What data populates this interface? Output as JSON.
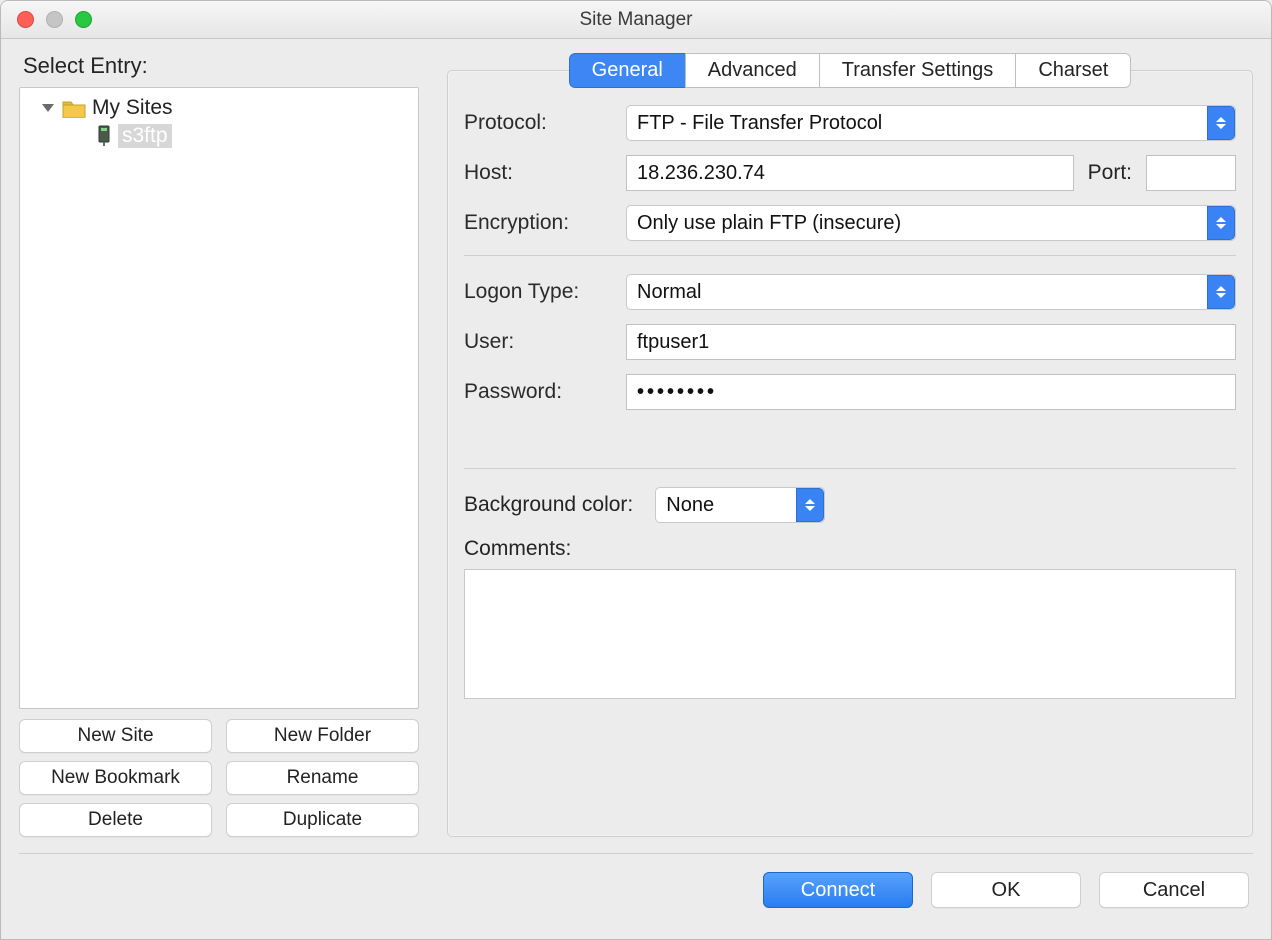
{
  "window": {
    "title": "Site Manager"
  },
  "left": {
    "header": "Select Entry:",
    "tree": {
      "root": {
        "label": "My Sites"
      },
      "site": {
        "label": "s3ftp"
      }
    },
    "buttons": {
      "new_site": "New Site",
      "new_folder": "New Folder",
      "new_bookmark": "New Bookmark",
      "rename": "Rename",
      "delete": "Delete",
      "duplicate": "Duplicate"
    }
  },
  "tabs": {
    "general": "General",
    "advanced": "Advanced",
    "transfer": "Transfer Settings",
    "charset": "Charset"
  },
  "form": {
    "protocol_label": "Protocol:",
    "protocol_value": "FTP - File Transfer Protocol",
    "host_label": "Host:",
    "host_value": "18.236.230.74",
    "port_label": "Port:",
    "port_value": "",
    "encryption_label": "Encryption:",
    "encryption_value": "Only use plain FTP (insecure)",
    "logon_label": "Logon Type:",
    "logon_value": "Normal",
    "user_label": "User:",
    "user_value": "ftpuser1",
    "password_label": "Password:",
    "password_value": "••••••••",
    "bgcolor_label": "Background color:",
    "bgcolor_value": "None",
    "comments_label": "Comments:",
    "comments_value": ""
  },
  "footer": {
    "connect": "Connect",
    "ok": "OK",
    "cancel": "Cancel"
  }
}
